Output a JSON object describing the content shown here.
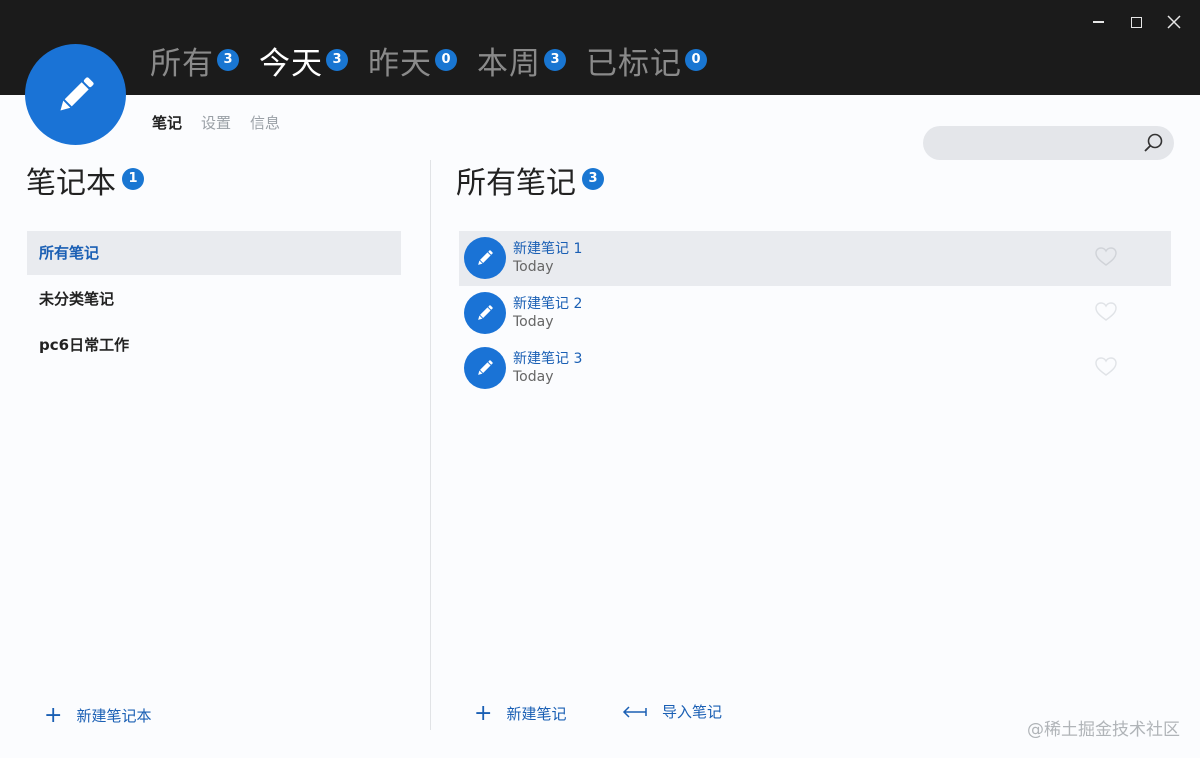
{
  "window": {
    "controls": {
      "minimize": "minimize",
      "maximize": "maximize",
      "close": "close"
    }
  },
  "tabs": [
    {
      "label": "所有",
      "count": "3",
      "active": false
    },
    {
      "label": "今天",
      "count": "3",
      "active": true
    },
    {
      "label": "昨天",
      "count": "0",
      "active": false
    },
    {
      "label": "本周",
      "count": "3",
      "active": false
    },
    {
      "label": "已标记",
      "count": "0",
      "active": false
    }
  ],
  "subtabs": [
    {
      "label": "笔记",
      "active": true
    },
    {
      "label": "设置",
      "active": false
    },
    {
      "label": "信息",
      "active": false
    }
  ],
  "search": {
    "placeholder": "",
    "value": ""
  },
  "notebooks": {
    "title": "笔记本",
    "count": "1",
    "items": [
      {
        "label": "所有笔记",
        "selected": true
      },
      {
        "label": "未分类笔记",
        "selected": false
      },
      {
        "label": "pc6日常工作",
        "selected": false
      }
    ],
    "new_notebook_label": "新建笔记本"
  },
  "notes": {
    "title": "所有笔记",
    "count": "3",
    "items": [
      {
        "title": "新建笔记 1",
        "date": "Today",
        "selected": true
      },
      {
        "title": "新建笔记 2",
        "date": "Today",
        "selected": false
      },
      {
        "title": "新建笔记 3",
        "date": "Today",
        "selected": false
      }
    ],
    "new_note_label": "新建笔记",
    "import_label": "导入笔记"
  },
  "watermark": "@稀土掘金技术社区",
  "colors": {
    "accent": "#1a73d6",
    "titlebar": "#1b1b1b",
    "selected_bg": "#e9ebef"
  },
  "icons": {
    "logo": "pencil-icon",
    "search": "search-icon",
    "favorite": "heart-icon",
    "add": "plus-icon",
    "import": "import-arrow-icon"
  }
}
